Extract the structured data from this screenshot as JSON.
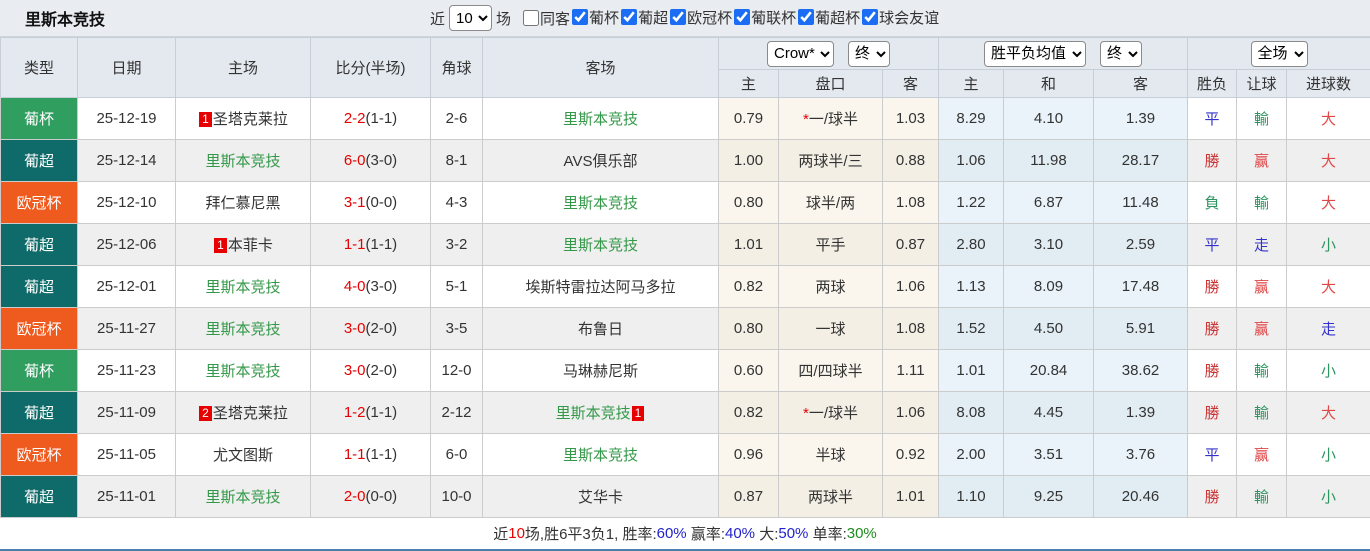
{
  "header": {
    "title": "里斯本竞技",
    "recent_label": "近",
    "recent_count": "10",
    "matches_label": "场",
    "same_opponent_label": "同客",
    "same_opponent_checked": false,
    "league_filters": [
      {
        "label": "葡杯",
        "checked": true
      },
      {
        "label": "葡超",
        "checked": true
      },
      {
        "label": "欧冠杯",
        "checked": true
      },
      {
        "label": "葡联杯",
        "checked": true
      },
      {
        "label": "葡超杯",
        "checked": true
      },
      {
        "label": "球会友谊",
        "checked": true
      }
    ]
  },
  "table": {
    "columns": [
      "类型",
      "日期",
      "主场",
      "比分(半场)",
      "角球",
      "客场"
    ],
    "selects": {
      "odds_source": "Crow*",
      "odds_time": "终",
      "avg_source": "胜平负均值",
      "avg_time": "终",
      "scope": "全场"
    },
    "sub_columns": [
      "主",
      "盘口",
      "客",
      "主",
      "和",
      "客",
      "胜负",
      "让球",
      "进球数"
    ],
    "league_colors": {
      "葡杯": "#2f9e5f",
      "葡超": "#0e6b69",
      "欧冠杯": "#ef5a1f"
    },
    "outcome_colors": {
      "勝": "#cc3333",
      "平": "#3333cc",
      "負": "#2e9460",
      "赢": "#e04444",
      "走": "#3333cc",
      "輸": "#2e9460",
      "大": "#e04848",
      "小": "#2e9460"
    },
    "rows": [
      {
        "league": "葡杯",
        "date": "25-12-19",
        "home": {
          "rank": "1",
          "name": "圣塔克莱拉",
          "self": false
        },
        "score": "2-2",
        "half": "(1-1)",
        "corners": "2-6",
        "away": {
          "rank": "",
          "name": "里斯本竞技",
          "self": true
        },
        "crow": {
          "home": "0.79",
          "star": true,
          "handicap": "一/球半",
          "away": "1.03"
        },
        "avg": {
          "home": "8.29",
          "draw": "4.10",
          "away": "1.39"
        },
        "outcome": {
          "result": "平",
          "handicap": "輸",
          "goals": "大"
        }
      },
      {
        "league": "葡超",
        "date": "25-12-14",
        "home": {
          "rank": "",
          "name": "里斯本竞技",
          "self": true
        },
        "score": "6-0",
        "half": "(3-0)",
        "corners": "8-1",
        "away": {
          "rank": "",
          "name": "AVS俱乐部",
          "self": false
        },
        "crow": {
          "home": "1.00",
          "star": false,
          "handicap": "两球半/三",
          "away": "0.88"
        },
        "avg": {
          "home": "1.06",
          "draw": "11.98",
          "away": "28.17"
        },
        "outcome": {
          "result": "勝",
          "handicap": "赢",
          "goals": "大"
        }
      },
      {
        "league": "欧冠杯",
        "date": "25-12-10",
        "home": {
          "rank": "",
          "name": "拜仁慕尼黑",
          "self": false
        },
        "score": "3-1",
        "half": "(0-0)",
        "corners": "4-3",
        "away": {
          "rank": "",
          "name": "里斯本竞技",
          "self": true
        },
        "crow": {
          "home": "0.80",
          "star": false,
          "handicap": "球半/两",
          "away": "1.08"
        },
        "avg": {
          "home": "1.22",
          "draw": "6.87",
          "away": "11.48"
        },
        "outcome": {
          "result": "負",
          "handicap": "輸",
          "goals": "大"
        }
      },
      {
        "league": "葡超",
        "date": "25-12-06",
        "home": {
          "rank": "1",
          "name": "本菲卡",
          "self": false
        },
        "score": "1-1",
        "half": "(1-1)",
        "corners": "3-2",
        "away": {
          "rank": "",
          "name": "里斯本竞技",
          "self": true
        },
        "crow": {
          "home": "1.01",
          "star": false,
          "handicap": "平手",
          "away": "0.87"
        },
        "avg": {
          "home": "2.80",
          "draw": "3.10",
          "away": "2.59"
        },
        "outcome": {
          "result": "平",
          "handicap": "走",
          "goals": "小"
        }
      },
      {
        "league": "葡超",
        "date": "25-12-01",
        "home": {
          "rank": "",
          "name": "里斯本竞技",
          "self": true
        },
        "score": "4-0",
        "half": "(3-0)",
        "corners": "5-1",
        "away": {
          "rank": "",
          "name": "埃斯特雷拉达阿马多拉",
          "self": false
        },
        "crow": {
          "home": "0.82",
          "star": false,
          "handicap": "两球",
          "away": "1.06"
        },
        "avg": {
          "home": "1.13",
          "draw": "8.09",
          "away": "17.48"
        },
        "outcome": {
          "result": "勝",
          "handicap": "赢",
          "goals": "大"
        }
      },
      {
        "league": "欧冠杯",
        "date": "25-11-27",
        "home": {
          "rank": "",
          "name": "里斯本竞技",
          "self": true
        },
        "score": "3-0",
        "half": "(2-0)",
        "corners": "3-5",
        "away": {
          "rank": "",
          "name": "布鲁日",
          "self": false
        },
        "crow": {
          "home": "0.80",
          "star": false,
          "handicap": "一球",
          "away": "1.08"
        },
        "avg": {
          "home": "1.52",
          "draw": "4.50",
          "away": "5.91"
        },
        "outcome": {
          "result": "勝",
          "handicap": "赢",
          "goals": "走"
        }
      },
      {
        "league": "葡杯",
        "date": "25-11-23",
        "home": {
          "rank": "",
          "name": "里斯本竞技",
          "self": true
        },
        "score": "3-0",
        "half": "(2-0)",
        "corners": "12-0",
        "away": {
          "rank": "",
          "name": "马琳赫尼斯",
          "self": false
        },
        "crow": {
          "home": "0.60",
          "star": false,
          "handicap": "四/四球半",
          "away": "1.11"
        },
        "avg": {
          "home": "1.01",
          "draw": "20.84",
          "away": "38.62"
        },
        "outcome": {
          "result": "勝",
          "handicap": "輸",
          "goals": "小"
        }
      },
      {
        "league": "葡超",
        "date": "25-11-09",
        "home": {
          "rank": "2",
          "name": "圣塔克莱拉",
          "self": false
        },
        "score": "1-2",
        "half": "(1-1)",
        "corners": "2-12",
        "away": {
          "rank": "1",
          "name": "里斯本竞技",
          "self": true
        },
        "crow": {
          "home": "0.82",
          "star": true,
          "handicap": "一/球半",
          "away": "1.06"
        },
        "avg": {
          "home": "8.08",
          "draw": "4.45",
          "away": "1.39"
        },
        "outcome": {
          "result": "勝",
          "handicap": "輸",
          "goals": "大"
        }
      },
      {
        "league": "欧冠杯",
        "date": "25-11-05",
        "home": {
          "rank": "",
          "name": "尤文图斯",
          "self": false
        },
        "score": "1-1",
        "half": "(1-1)",
        "corners": "6-0",
        "away": {
          "rank": "",
          "name": "里斯本竞技",
          "self": true
        },
        "crow": {
          "home": "0.96",
          "star": false,
          "handicap": "半球",
          "away": "0.92"
        },
        "avg": {
          "home": "2.00",
          "draw": "3.51",
          "away": "3.76"
        },
        "outcome": {
          "result": "平",
          "handicap": "赢",
          "goals": "小"
        }
      },
      {
        "league": "葡超",
        "date": "25-11-01",
        "home": {
          "rank": "",
          "name": "里斯本竞技",
          "self": true
        },
        "score": "2-0",
        "half": "(0-0)",
        "corners": "10-0",
        "away": {
          "rank": "",
          "name": "艾华卡",
          "self": false
        },
        "crow": {
          "home": "0.87",
          "star": false,
          "handicap": "两球半",
          "away": "1.01"
        },
        "avg": {
          "home": "1.10",
          "draw": "9.25",
          "away": "20.46"
        },
        "outcome": {
          "result": "勝",
          "handicap": "輸",
          "goals": "小"
        }
      }
    ]
  },
  "footer": {
    "segments": [
      {
        "text": "近",
        "color": "#333333"
      },
      {
        "text": "10",
        "color": "#e60000"
      },
      {
        "text": "场,胜6平3负1, 胜率:",
        "color": "#333333"
      },
      {
        "text": "60%",
        "color": "#2222cc"
      },
      {
        "text": " 赢率:",
        "color": "#333333"
      },
      {
        "text": "40%",
        "color": "#2222cc"
      },
      {
        "text": " 大:",
        "color": "#333333"
      },
      {
        "text": "50%",
        "color": "#2222cc"
      },
      {
        "text": " 单率:",
        "color": "#333333"
      },
      {
        "text": "30%",
        "color": "#1e8c1e"
      }
    ]
  }
}
